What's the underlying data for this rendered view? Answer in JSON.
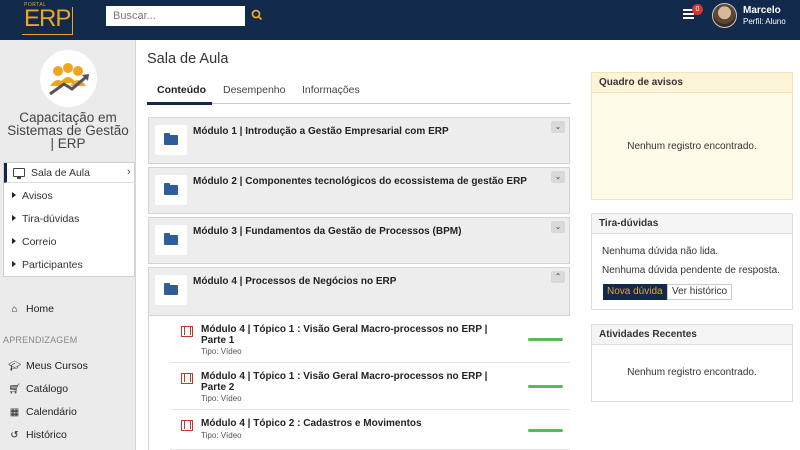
{
  "header": {
    "logo_small": "PORTAL",
    "logo": "ERP",
    "search_placeholder": "Buscar...",
    "notification_count": "0",
    "user_name": "Marcelo",
    "user_role": "Perfil: Aluno"
  },
  "sidebar": {
    "course_title": "Capacitação em Sistemas de Gestão | ERP",
    "current": "Sala de Aula",
    "subitems": [
      "Avisos",
      "Tira-dúvidas",
      "Correio",
      "Participantes"
    ],
    "home": "Home",
    "section": "APRENDIZAGEM",
    "items": [
      "Meus Cursos",
      "Catálogo",
      "Calendário",
      "Histórico"
    ]
  },
  "main": {
    "title": "Sala de Aula",
    "tabs": [
      "Conteúdo",
      "Desempenho",
      "Informações"
    ],
    "modules": [
      "Módulo 1 | Introdução a Gestão Empresarial com ERP",
      "Módulo 2 | Componentes tecnológicos do ecossistema de gestão ERP",
      "Módulo 3 | Fundamentos da Gestão de Processos (BPM)",
      "Módulo 4 | Processos de Negócios no ERP"
    ],
    "lessons": [
      {
        "title": "Módulo 4 | Tópico 1 : Visão Geral Macro-processos no ERP | Parte 1",
        "type": "Tipo: Vídeo",
        "progress": 1.0
      },
      {
        "title": "Módulo 4 | Tópico 1 : Visão Geral Macro-processos no ERP | Parte 2",
        "type": "Tipo: Vídeo",
        "progress": 1.0
      },
      {
        "title": "Módulo 4 | Tópico 2 : Cadastros e Movimentos",
        "type": "Tipo: Vídeo",
        "progress": 1.0
      }
    ]
  },
  "panels": {
    "notices": {
      "title": "Quadro de avisos",
      "empty": "Nenhum registro encontrado."
    },
    "questions": {
      "title": "Tira-dúvidas",
      "line1": "Nenhuma dúvida não lida.",
      "line2": "Nenhuma dúvida pendente de resposta.",
      "new_button": "Nova dúvida",
      "history_button": "Ver histórico"
    },
    "recent": {
      "title": "Atividades Recentes",
      "empty": "Nenhum registro encontrado."
    }
  },
  "colors": {
    "navy": "#11294b",
    "accent": "#f0a51e",
    "progress": "#5cb85c"
  }
}
